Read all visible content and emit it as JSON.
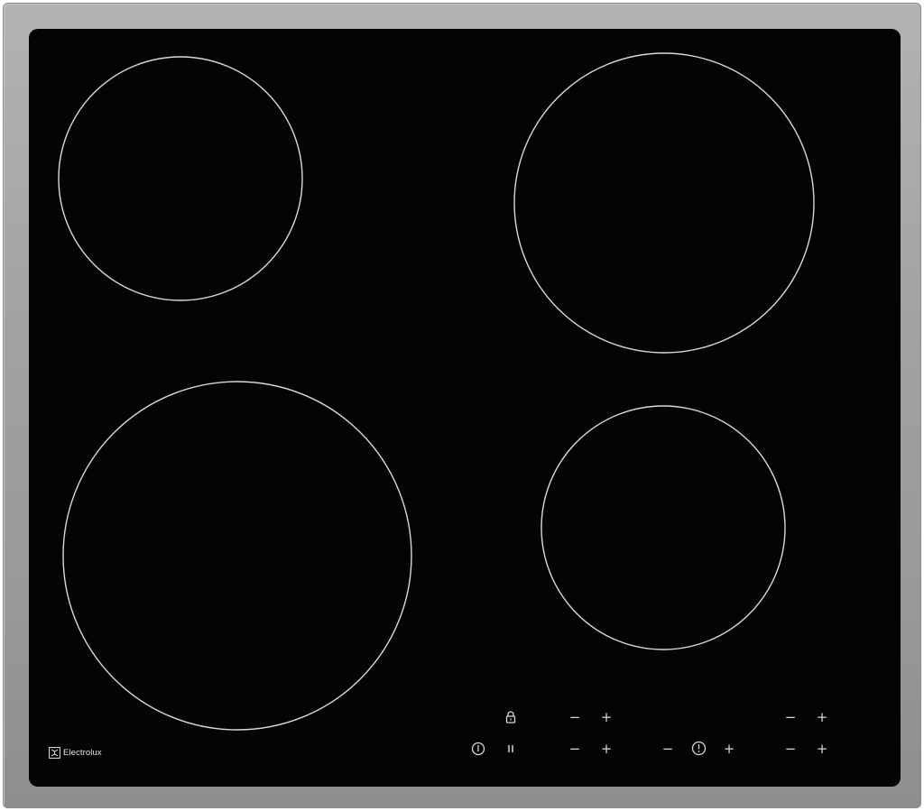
{
  "hob": {
    "brand": "Electrolux",
    "colors": {
      "frame": "#a3a3a3",
      "glass": "#040406",
      "zone_ring": "#d9d9d9",
      "controls": "#d8d8d8"
    },
    "zones": [
      {
        "name": "rear-left-zone"
      },
      {
        "name": "rear-right-zone"
      },
      {
        "name": "front-left-zone"
      },
      {
        "name": "front-right-zone"
      }
    ],
    "controls": {
      "lock_icon": "lock-icon",
      "power_icon": "power-icon",
      "pause_icon": "pause-icon",
      "timer_icon": "timer-icon",
      "minus_symbol": "−",
      "plus_symbol": "+"
    }
  }
}
